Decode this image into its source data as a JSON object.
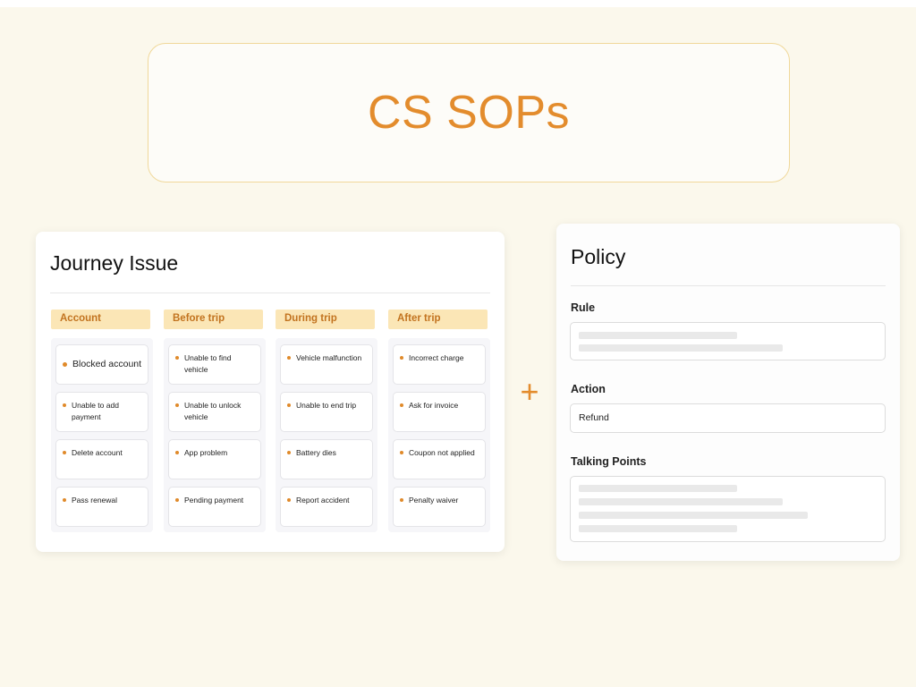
{
  "title": "CS SOPs",
  "journey": {
    "title": "Journey Issue",
    "columns": [
      {
        "header": "Account",
        "items": [
          "Blocked account",
          "Unable to add payment",
          "Delete account",
          "Pass renewal"
        ]
      },
      {
        "header": "Before trip",
        "items": [
          "Unable to find vehicle",
          "Unable to unlock vehicle",
          "App problem",
          "Pending payment"
        ]
      },
      {
        "header": "During trip",
        "items": [
          "Vehicle malfunction",
          "Unable to end trip",
          "Battery dies",
          "Report accident"
        ]
      },
      {
        "header": "After trip",
        "items": [
          "Incorrect charge",
          "Ask for invoice",
          "Coupon not applied",
          "Penalty waiver"
        ]
      }
    ]
  },
  "connector": "+",
  "policy": {
    "title": "Policy",
    "rule": {
      "label": "Rule"
    },
    "action": {
      "label": "Action",
      "value": "Refund"
    },
    "talking_points": {
      "label": "Talking Points"
    }
  },
  "colors": {
    "accent": "#e38c2d",
    "background": "#fbf8ec",
    "header_fill": "#fbe6b6",
    "bullet": "#e08a2a"
  },
  "icons": [
    "plus-icon",
    "bullet-dot-icon"
  ]
}
